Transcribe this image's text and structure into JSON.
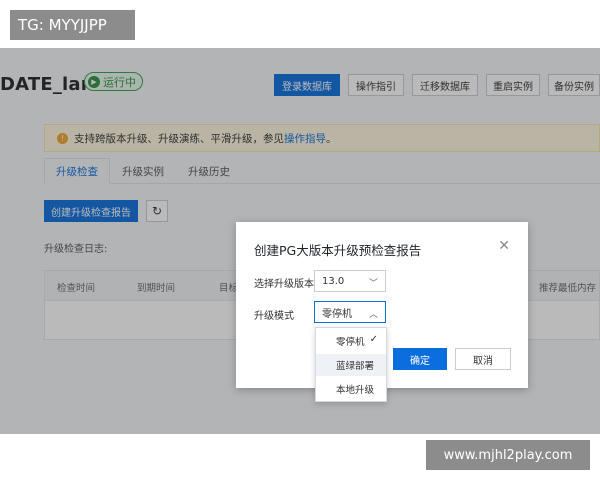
{
  "watermark": {
    "top_label": "TG: MYYJJPP",
    "bottom_label": "www.mjhl2play.com"
  },
  "instance": {
    "title": "DATE_lanlv",
    "status": "运行中"
  },
  "top_actions": [
    {
      "label": "登录数据库",
      "primary": true
    },
    {
      "label": "操作指引",
      "primary": false
    },
    {
      "label": "迁移数据库",
      "primary": false
    },
    {
      "label": "重启实例",
      "primary": false
    },
    {
      "label": "备份实例",
      "primary": false
    }
  ],
  "notice": {
    "text": "支持跨版本升级、升级演练、平滑升级，参见",
    "link": "操作指导",
    "suffix": "。"
  },
  "tabs": [
    {
      "label": "升级检查",
      "active": true
    },
    {
      "label": "升级实例",
      "active": false
    },
    {
      "label": "升级历史",
      "active": false
    }
  ],
  "toolbar": {
    "create_label": "创建升级检查报告",
    "refresh_icon": "refresh-icon"
  },
  "log_label": "升级检查日志:",
  "table": {
    "columns": [
      "检查时间",
      "到期时间",
      "目标",
      "推荐最低内存"
    ]
  },
  "modal": {
    "title": "创建PG大版本升级预检查报告",
    "version_label": "选择升级版本:",
    "version_value": "13.0",
    "mode_label": "升级模式",
    "mode_value": "零停机",
    "ok_label": "确定",
    "cancel_label": "取消"
  },
  "dropdown": {
    "options": [
      {
        "label": "零停机",
        "selected": true
      },
      {
        "label": "蓝绿部署",
        "selected": false
      },
      {
        "label": "本地升级",
        "selected": false
      }
    ],
    "check": "✓"
  },
  "colors": {
    "primary": "#0a6ede",
    "success": "#2b8f43",
    "warning": "#f0a52c"
  }
}
